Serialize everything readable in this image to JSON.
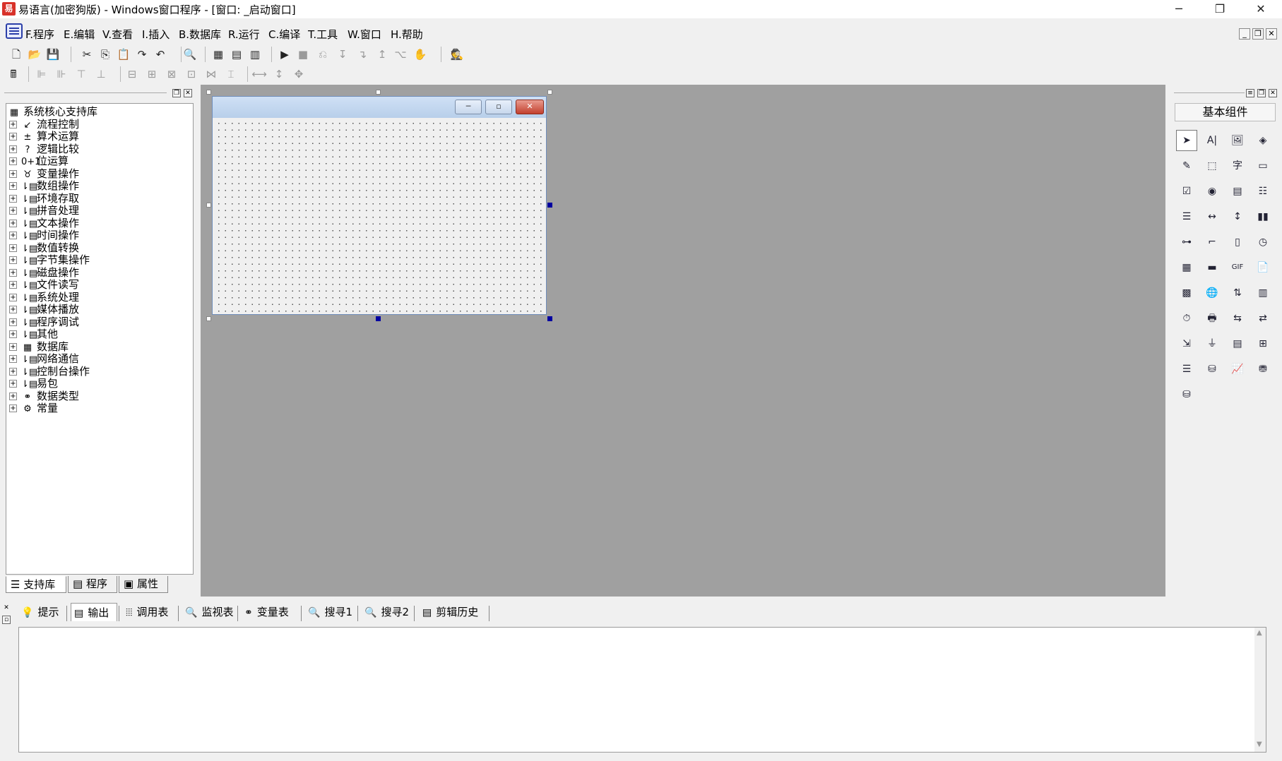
{
  "window": {
    "title": "易语言(加密狗版) - Windows窗口程序 - [窗口: _启动窗口]",
    "controls": {
      "minimize": "─",
      "restore": "❐",
      "close": "✕"
    }
  },
  "menu": {
    "items": [
      "F.程序",
      "E.编辑",
      "V.查看",
      "I.插入",
      "B.数据库",
      "R.运行",
      "C.编译",
      "T.工具",
      "W.窗口",
      "H.帮助"
    ],
    "mdi_controls": [
      "_",
      "❐",
      "✕"
    ]
  },
  "toolbar1": {
    "buttons": [
      {
        "name": "new-icon",
        "glyph": "🗋"
      },
      {
        "name": "open-icon",
        "glyph": "📂"
      },
      {
        "name": "save-icon",
        "glyph": "💾"
      },
      {
        "name": "cut-icon",
        "glyph": "✂"
      },
      {
        "name": "copy-icon",
        "glyph": "⎘"
      },
      {
        "name": "paste-icon",
        "glyph": "📋"
      },
      {
        "name": "redo-icon",
        "glyph": "↷"
      },
      {
        "name": "undo-icon",
        "glyph": "↶"
      },
      {
        "name": "find-icon",
        "glyph": "🔍"
      },
      {
        "name": "layout1-icon",
        "glyph": "▦"
      },
      {
        "name": "layout2-icon",
        "glyph": "▤"
      },
      {
        "name": "layout3-icon",
        "glyph": "▥"
      },
      {
        "name": "run-icon",
        "glyph": "▶"
      },
      {
        "name": "stop-icon",
        "glyph": "■"
      },
      {
        "name": "step-icon",
        "glyph": "⎌"
      },
      {
        "name": "step-into-icon",
        "glyph": "↧"
      },
      {
        "name": "step-over-icon",
        "glyph": "↴"
      },
      {
        "name": "step-out-icon",
        "glyph": "↥"
      },
      {
        "name": "run-to-cursor-icon",
        "glyph": "⌥"
      },
      {
        "name": "hand-icon",
        "glyph": "✋"
      },
      {
        "name": "debug-person-icon",
        "glyph": "🕵"
      }
    ]
  },
  "toolbar2": {
    "buttons": [
      {
        "name": "calculator-icon",
        "glyph": "🖩"
      },
      {
        "name": "align-left-icon",
        "glyph": "⊫"
      },
      {
        "name": "align-right-icon",
        "glyph": "⊪"
      },
      {
        "name": "align-top-icon",
        "glyph": "⊤"
      },
      {
        "name": "align-bottom-icon",
        "glyph": "⊥"
      },
      {
        "name": "center-horizontal-icon",
        "glyph": "⊟"
      },
      {
        "name": "center-vertical-icon",
        "glyph": "⊞"
      },
      {
        "name": "same-width-icon",
        "glyph": "⊠"
      },
      {
        "name": "same-height-icon",
        "glyph": "⊡"
      },
      {
        "name": "space-horizontal-icon",
        "glyph": "⋈"
      },
      {
        "name": "space-vertical-icon",
        "glyph": "⌶"
      },
      {
        "name": "fit-width-icon",
        "glyph": "⟷"
      },
      {
        "name": "fit-height-icon",
        "glyph": "↕"
      },
      {
        "name": "fit-both-icon",
        "glyph": "✥"
      }
    ]
  },
  "left_panel": {
    "tree": [
      {
        "label": "系统核心支持库",
        "icon": "▦",
        "expander": ""
      },
      {
        "label": "流程控制",
        "icon": "↙",
        "expander": "+"
      },
      {
        "label": "算术运算",
        "icon": "±",
        "expander": "+"
      },
      {
        "label": "逻辑比较",
        "icon": "?",
        "expander": "+"
      },
      {
        "label": "位运算",
        "icon": "0+1",
        "expander": "+"
      },
      {
        "label": "变量操作",
        "icon": "♉",
        "expander": "+"
      },
      {
        "label": "数组操作",
        "icon": "⇂▤",
        "expander": "+"
      },
      {
        "label": "环境存取",
        "icon": "⇂▤",
        "expander": "+"
      },
      {
        "label": "拼音处理",
        "icon": "⇂▤",
        "expander": "+"
      },
      {
        "label": "文本操作",
        "icon": "⇂▤",
        "expander": "+"
      },
      {
        "label": "时间操作",
        "icon": "⇂▤",
        "expander": "+"
      },
      {
        "label": "数值转换",
        "icon": "⇂▤",
        "expander": "+"
      },
      {
        "label": "字节集操作",
        "icon": "⇂▤",
        "expander": "+"
      },
      {
        "label": "磁盘操作",
        "icon": "⇂▤",
        "expander": "+"
      },
      {
        "label": "文件读写",
        "icon": "⇂▤",
        "expander": "+"
      },
      {
        "label": "系统处理",
        "icon": "⇂▤",
        "expander": "+"
      },
      {
        "label": "媒体播放",
        "icon": "⇂▤",
        "expander": "+"
      },
      {
        "label": "程序调试",
        "icon": "⇂▤",
        "expander": "+"
      },
      {
        "label": "其他",
        "icon": "⇂▤",
        "expander": "+"
      },
      {
        "label": "数据库",
        "icon": "▦",
        "expander": "+"
      },
      {
        "label": "网络通信",
        "icon": "⇂▤",
        "expander": "+"
      },
      {
        "label": "控制台操作",
        "icon": "⇂▤",
        "expander": "+"
      },
      {
        "label": "易包",
        "icon": "⇂▤",
        "expander": "+"
      },
      {
        "label": "数据类型",
        "icon": "⚭",
        "expander": "+"
      },
      {
        "label": "常量",
        "icon": "⚙",
        "expander": "+"
      }
    ],
    "tabs": [
      {
        "label": "支持库",
        "icon": "☰"
      },
      {
        "label": "程序",
        "icon": "▤"
      },
      {
        "label": "属性",
        "icon": "▣"
      }
    ]
  },
  "form": {
    "buttons": {
      "minimize": "─",
      "maximize": "▫",
      "close": "✕"
    }
  },
  "right_panel": {
    "header": "基本组件",
    "components": [
      {
        "name": "pointer-icon",
        "glyph": "➤"
      },
      {
        "name": "label-icon",
        "glyph": "A|"
      },
      {
        "name": "picture-icon",
        "glyph": "🖼"
      },
      {
        "name": "shape-icon",
        "glyph": "◈"
      },
      {
        "name": "editbox-icon",
        "glyph": "✎"
      },
      {
        "name": "panel-icon",
        "glyph": "⬚"
      },
      {
        "name": "text-icon",
        "glyph": "字"
      },
      {
        "name": "button-icon",
        "glyph": "▭"
      },
      {
        "name": "checkbox-icon",
        "glyph": "☑"
      },
      {
        "name": "radio-icon",
        "glyph": "◉"
      },
      {
        "name": "combobox-icon",
        "glyph": "▤"
      },
      {
        "name": "listbox-icon",
        "glyph": "☷"
      },
      {
        "name": "checklist-icon",
        "glyph": "☰"
      },
      {
        "name": "hscroll-icon",
        "glyph": "↔"
      },
      {
        "name": "vscroll-icon",
        "glyph": "↕"
      },
      {
        "name": "progress-icon",
        "glyph": "▮▮"
      },
      {
        "name": "slider-icon",
        "glyph": "⊶"
      },
      {
        "name": "tab-icon",
        "glyph": "⌐"
      },
      {
        "name": "frame-icon",
        "glyph": "▯"
      },
      {
        "name": "clock-icon",
        "glyph": "◷"
      },
      {
        "name": "calendar-icon",
        "glyph": "▦"
      },
      {
        "name": "statusbar-icon",
        "glyph": "▬"
      },
      {
        "name": "gif-icon",
        "glyph": "GIF"
      },
      {
        "name": "document-icon",
        "glyph": "📄"
      },
      {
        "name": "color-icon",
        "glyph": "▩"
      },
      {
        "name": "globe-icon",
        "glyph": "🌐"
      },
      {
        "name": "updown-icon",
        "glyph": "⇅"
      },
      {
        "name": "grid-icon",
        "glyph": "▥"
      },
      {
        "name": "timer-icon",
        "glyph": "⏱"
      },
      {
        "name": "printer-icon",
        "glyph": "🖶"
      },
      {
        "name": "data-source-icon",
        "glyph": "⇆"
      },
      {
        "name": "data-provider-icon",
        "glyph": "⇄"
      },
      {
        "name": "network-icon",
        "glyph": "⇲"
      },
      {
        "name": "funnel-icon",
        "glyph": "⏚"
      },
      {
        "name": "table-icon",
        "glyph": "▤"
      },
      {
        "name": "tree-icon",
        "glyph": "⊞"
      },
      {
        "name": "list-link-icon",
        "glyph": "☰"
      },
      {
        "name": "db-link-icon",
        "glyph": "⛁"
      },
      {
        "name": "chart-icon",
        "glyph": "📈"
      },
      {
        "name": "odbc-icon",
        "glyph": "⛃"
      },
      {
        "name": "odbc2-icon",
        "glyph": "⛁"
      }
    ]
  },
  "bottom_panel": {
    "tabs": [
      {
        "label": "提示",
        "icon": "💡"
      },
      {
        "label": "输出",
        "icon": "▤"
      },
      {
        "label": "调用表",
        "icon": "⦙⦙⦙"
      },
      {
        "label": "监视表",
        "icon": "🔍"
      },
      {
        "label": "变量表",
        "icon": "⚭"
      },
      {
        "label": "搜寻1",
        "icon": "🔍"
      },
      {
        "label": "搜寻2",
        "icon": "🔍"
      },
      {
        "label": "剪辑历史",
        "icon": "▤"
      }
    ],
    "output_text": ""
  }
}
